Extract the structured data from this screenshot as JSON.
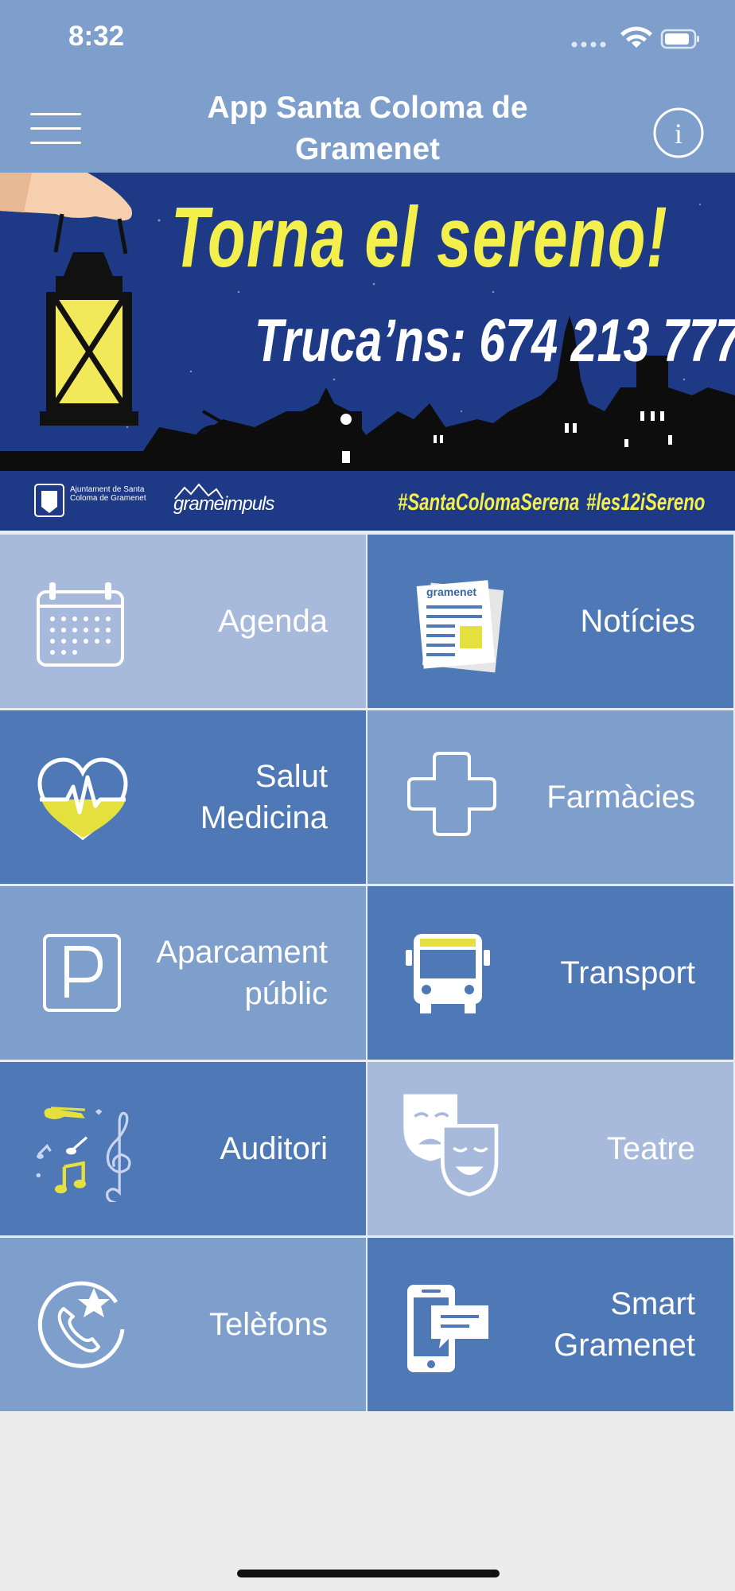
{
  "status": {
    "time": "8:32"
  },
  "header": {
    "title": "App Santa Coloma de Gramenet",
    "menu_icon": "hamburger-menu-icon",
    "info_icon": "info-icon"
  },
  "banner": {
    "headline": "Torna el sereno!",
    "phone": "Truca’ns: 674 213 777",
    "logo_ajuntament": "Ajuntament de Santa Coloma de Gramenet",
    "logo_grameimpuls": "grameimpuls",
    "hashtag1": "#SantaColomaSerena",
    "hashtag2": "#les12iSereno",
    "colors": {
      "background": "#1e3a86",
      "headline": "#f3ef4c"
    }
  },
  "tiles": [
    {
      "label": "Agenda",
      "icon": "calendar-icon",
      "color": "#a7badb"
    },
    {
      "label": "Notícies",
      "icon": "newspaper-icon",
      "color": "#4e78b6",
      "icon_text": "gramenet"
    },
    {
      "label": "Salut\nMedicina",
      "icon": "heart-pulse-icon",
      "color": "#4e78b6"
    },
    {
      "label": "Farmàcies",
      "icon": "pharmacy-cross-icon",
      "color": "#7e9ecb"
    },
    {
      "label": "Aparcament\npúblic",
      "icon": "parking-icon",
      "color": "#7e9ecb"
    },
    {
      "label": "Transport",
      "icon": "bus-icon",
      "color": "#4e78b6"
    },
    {
      "label": "Auditori",
      "icon": "music-notes-icon",
      "color": "#4e78b6"
    },
    {
      "label": "Teatre",
      "icon": "theatre-masks-icon",
      "color": "#a7badb"
    },
    {
      "label": "Telèfons",
      "icon": "phone-star-icon",
      "color": "#7e9ecb"
    },
    {
      "label": "Smart\nGramenet",
      "icon": "smartphone-message-icon",
      "color": "#4e78b6"
    }
  ],
  "colors": {
    "topbar": "#7e9fcb",
    "background": "#ececec"
  }
}
